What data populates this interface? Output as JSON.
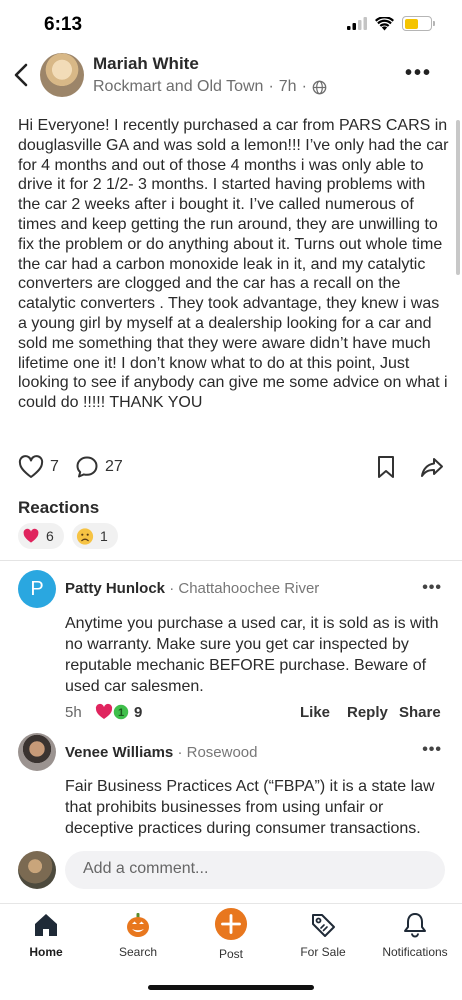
{
  "status": {
    "time": "6:13"
  },
  "post": {
    "author": "Mariah White",
    "neighborhood": "Rockmart and Old Town",
    "age": "7h",
    "body": "Hi Everyone! I recently purchased a car from PARS CARS in douglasville GA and was sold a lemon!!! I’ve only had the car for 4 months and out of those 4 months i was only able to drive it for 2 1/2- 3 months. I started having problems with the car 2 weeks after i bought it. I’ve called numerous of times and keep getting the run around, they are unwilling to fix the problem or do anything about it. Turns out whole time the car had a carbon monoxide leak in it, and my catalytic converters are clogged and the car has a recall on the catalytic converters . They took advantage, they knew i was a young girl by myself at a dealership looking for a car and sold me something that they were aware didn’t have much lifetime one it! I don’t know what to do at this point, Just looking to see if anybody can give me some advice on what i could do !!!!! THANK YOU",
    "like_count": "7",
    "comment_count": "27"
  },
  "reactions": {
    "title": "Reactions",
    "items": [
      {
        "icon": "heart-emoji",
        "count": "6"
      },
      {
        "icon": "sad-face-emoji",
        "count": "1"
      }
    ]
  },
  "comments": [
    {
      "avatar_letter": "P",
      "avatar_color": "#2aa7e0",
      "name": "Patty Hunlock",
      "neighborhood": "Chattahoochee River",
      "text": "Anytime you purchase a used car, it is sold as is with no warranty. Make sure you get car inspected by reputable mechanic BEFORE purchase. Beware of used car salesmen.",
      "age": "5h",
      "reaction_count": "9",
      "like_label": "Like",
      "reply_label": "Reply",
      "share_label": "Share"
    },
    {
      "name": "Venee Williams",
      "neighborhood": "Rosewood",
      "text": "Fair Business Practices Act (“FBPA”) it is a state law that prohibits businesses from using unfair or deceptive practices during consumer transactions."
    }
  ],
  "comment_input": {
    "placeholder": "Add a comment..."
  },
  "nav": {
    "items": [
      {
        "label": "Home",
        "icon": "home-icon",
        "active": true
      },
      {
        "label": "Search",
        "icon": "pumpkin-search-icon"
      },
      {
        "label": "Post",
        "icon": "plus-circle-icon"
      },
      {
        "label": "For Sale",
        "icon": "price-tag-icon"
      },
      {
        "label": "Notifications",
        "icon": "bell-icon"
      }
    ]
  },
  "colors": {
    "accent": "#e8771e",
    "brand_dark": "#1f2a37",
    "reaction_green": "#3fbf4b",
    "heart_red": "#e0245e"
  }
}
